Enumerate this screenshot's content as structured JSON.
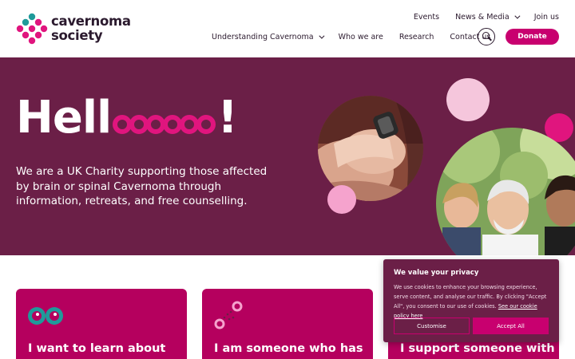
{
  "brand": {
    "line1": "cavernoma",
    "line2": "society"
  },
  "top_nav": [
    {
      "label": "Events",
      "has_dropdown": false
    },
    {
      "label": "News & Media",
      "has_dropdown": true
    },
    {
      "label": "Join us",
      "has_dropdown": false
    }
  ],
  "main_nav": [
    {
      "label": "Understanding Cavernoma",
      "has_dropdown": true
    },
    {
      "label": "Who we are",
      "has_dropdown": false
    },
    {
      "label": "Research",
      "has_dropdown": false
    },
    {
      "label": "Contact us",
      "has_dropdown": false
    }
  ],
  "donate_label": "Donate",
  "hero": {
    "hello_prefix": "Hell",
    "hello_suffix": "!",
    "o_count": 6,
    "subtitle": "We are a UK Charity supporting those affected by brain or spinal Cavernoma through information, retreats, and free counselling."
  },
  "cards": [
    {
      "title": "I want to learn about"
    },
    {
      "title": "I am someone who has"
    },
    {
      "title": "I support someone with"
    }
  ],
  "cookie": {
    "title": "We value your privacy",
    "text": "We use cookies to enhance your browsing experience, serve content, and analyse our traffic. By clicking \"Accept All\", you consent to our use of cookies.",
    "link": "See our cookie policy here",
    "customise_label": "Customise",
    "accept_label": "Accept All"
  },
  "colors": {
    "plum": "#6b1f47",
    "magenta": "#c8006f",
    "card": "#b5005e",
    "pink_light": "#f5c6dc",
    "teal": "#1f9a9a"
  }
}
